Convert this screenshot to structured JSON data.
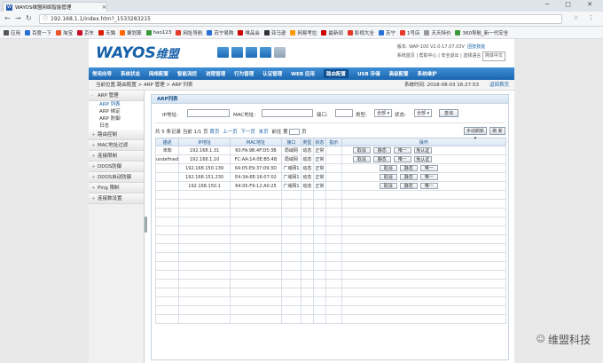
{
  "browser": {
    "tab_title": "WAYOS维盟网络智能管理",
    "url": "192.168.1.1/index.htm?_1533283215"
  },
  "bookmarks": [
    "应用",
    "百度一下",
    "淘宝",
    "京东",
    "天猫",
    "聚划算",
    "hao123",
    "网址导航",
    "苏宁易购",
    "唯品会",
    "亚马逊",
    "网易考拉",
    "最新闻",
    "影视大全",
    "苏宁",
    "1号店",
    "天天特价",
    "360导航_新一代安全"
  ],
  "header": {
    "logo": "WAYOS",
    "logo_cn": "维盟",
    "device": "版本: WAP-100 V2.0-17.07.03V",
    "tech": "团技技能",
    "links": "系统首页 | 帮助中心 | 安全退出 | 选择语言",
    "lang": "简体中文"
  },
  "menu": [
    "常用向导",
    "系统状态",
    "网络配置",
    "智能流控",
    "进程管理",
    "行为管理",
    "认证管理",
    "WEB 应用",
    "路由配置",
    "USB 存储",
    "高级配置",
    "系统维护"
  ],
  "menu_active": 8,
  "breadcrumb": {
    "path": "当前位置:路由配置 > ARP 管理 > ARP 列表",
    "time": "系统时间: 2018-08-03 16:27:53",
    "home": "返回首页"
  },
  "sidebar": {
    "groups": [
      {
        "label": "ARP 管理",
        "open": true,
        "subs": [
          "ARP 列表",
          "ARP 绑定",
          "ARP 防御",
          "日志"
        ]
      },
      {
        "label": "路由控制"
      },
      {
        "label": "MAC地址过滤"
      },
      {
        "label": "连接限制"
      },
      {
        "label": "DDOS防御"
      },
      {
        "label": "DDOS自动防御"
      },
      {
        "label": "Ping 限制"
      },
      {
        "label": "连接数设置"
      }
    ]
  },
  "panel": {
    "title": "ARP列表",
    "ip_label": "IP地址:",
    "mac_label": "MAC地址:",
    "port_label": "接口:",
    "type_label": "类型:",
    "type_val": "全部",
    "status_label": "状态:",
    "status_val": "全部",
    "query": "查询"
  },
  "pager": {
    "summary": "共 5 条记录  当前 1/1 页",
    "first": "首页",
    "prev": "上一页",
    "next": "下一页",
    "last": "末页",
    "goto": "前往 第",
    "page_unit": "页",
    "manual": "手动刷新",
    "refresh": "刷 新"
  },
  "table": {
    "headers": [
      "描述",
      "IP地址",
      "MAC地址",
      "接口",
      "类型",
      "状态",
      "指示",
      "操作"
    ],
    "rows": [
      {
        "desc": "未知",
        "ip": "192.168.1.31",
        "mac": "60:FA:9B:4F:D5:3B",
        "iface": "局域网",
        "type": "动态",
        "status": "正常",
        "ops": [
          "取消",
          "静态",
          "唯一",
          "免认证"
        ]
      },
      {
        "desc": "undefined",
        "ip": "192.168.1.10",
        "mac": "FC:AA:14:0E:B5:4B",
        "iface": "局域网",
        "type": "动态",
        "status": "正常",
        "ops": [
          "取消",
          "静态",
          "唯一",
          "免认证"
        ]
      },
      {
        "desc": "",
        "ip": "192.168.150.139",
        "mac": "64:05:E9:37:09:3D",
        "iface": "广域网1",
        "type": "动态",
        "status": "正常",
        "ops": [
          "取消",
          "静态",
          "唯一"
        ]
      },
      {
        "desc": "",
        "ip": "192.168.151.230",
        "mac": "E4:3A:6E:16:07:02",
        "iface": "广域网1",
        "type": "动态",
        "status": "正常",
        "ops": [
          "取消",
          "静态",
          "唯一"
        ]
      },
      {
        "desc": "",
        "ip": "192.168.150.1",
        "mac": "64:05:F9:12:A0:25",
        "iface": "广域网1",
        "type": "动态",
        "status": "正常",
        "ops": [
          "取消",
          "静态",
          "唯一"
        ]
      }
    ],
    "empty_rows": 15
  },
  "watermark": "维盟科技"
}
